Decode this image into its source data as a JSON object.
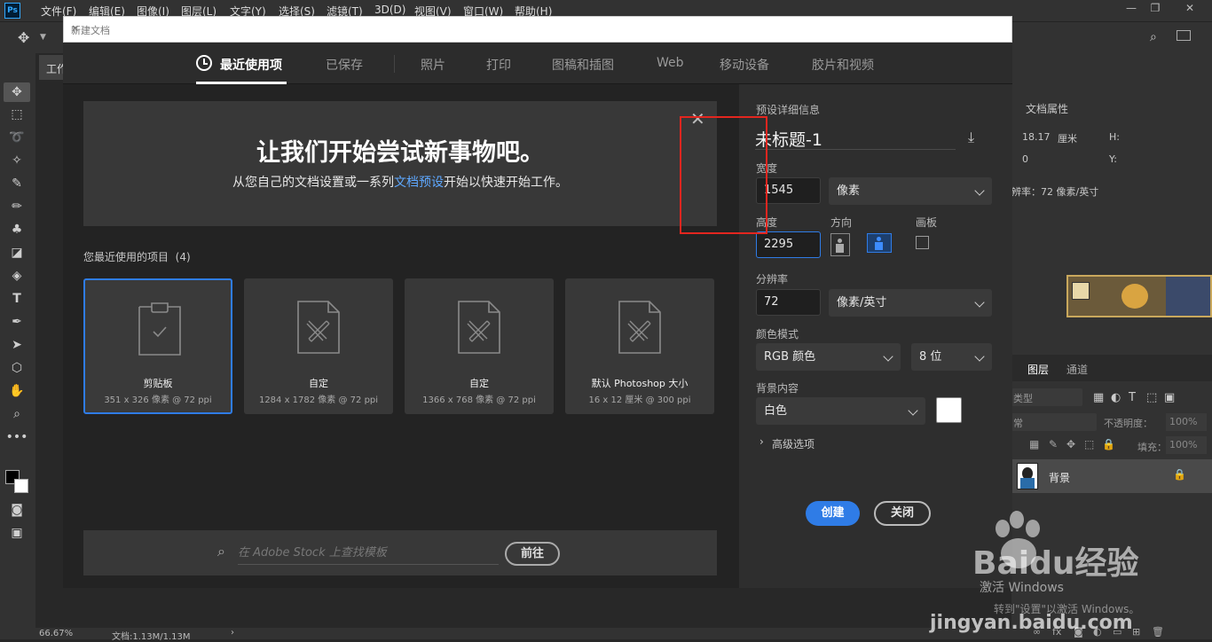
{
  "menubar": {
    "logo": "Ps",
    "items": [
      "文件(F)",
      "编辑(E)",
      "图像(I)",
      "图层(L)",
      "文字(Y)",
      "选择(S)",
      "滤镜(T)",
      "3D(D)",
      "视图(V)",
      "窗口(W)",
      "帮助(H)"
    ]
  },
  "workspace_tab": "工作",
  "dialog": {
    "title": "新建文档",
    "tabs": [
      "最近使用项",
      "已保存",
      "照片",
      "打印",
      "图稿和插图",
      "Web",
      "移动设备",
      "胶片和视频"
    ],
    "active_tab": 0,
    "welcome": {
      "title": "让我们开始尝试新事物吧。",
      "sub_before": "从您自己的文档设置或一系列",
      "sub_link": "文档预设",
      "sub_after": "开始以快速开始工作。"
    },
    "recent_label": "您最近使用的项目",
    "recent_count": "(4)",
    "recent": [
      {
        "name": "剪贴板",
        "detail": "351 x 326 像素 @ 72 ppi",
        "selected": true,
        "icon": "clipboard-icon"
      },
      {
        "name": "自定",
        "detail": "1284 x 1782 像素 @ 72 ppi",
        "selected": false,
        "icon": "document-ruler-icon"
      },
      {
        "name": "自定",
        "detail": "1366 x 768 像素 @ 72 ppi",
        "selected": false,
        "icon": "document-ruler-icon"
      },
      {
        "name": "默认 Photoshop 大小",
        "detail": "16 x 12 厘米 @ 300 ppi",
        "selected": false,
        "icon": "document-ruler-icon"
      }
    ],
    "stock": {
      "placeholder": "在 Adobe Stock 上查找模板",
      "button": "前往"
    },
    "details": {
      "header": "预设详细信息",
      "doc_name": "未标题-1",
      "width_label": "宽度",
      "width_value": "1545",
      "width_unit": "像素",
      "height_label": "高度",
      "height_value": "2295",
      "orientation_label": "方向",
      "artboard_label": "画板",
      "resolution_label": "分辨率",
      "resolution_value": "72",
      "resolution_unit": "像素/英寸",
      "color_mode_label": "颜色模式",
      "color_mode": "RGB 颜色",
      "bit_depth": "8 位",
      "background_label": "背景内容",
      "background": "白色",
      "advanced": "高级选项",
      "create": "创建",
      "close": "关闭"
    }
  },
  "rpanel": {
    "doc_props": "文档属性",
    "w_value": "18.17",
    "w_unit": "厘米",
    "h_label": "H:",
    "x_value": "0",
    "y_label": "Y:",
    "resolution": "辨率：72 像素/英寸",
    "layers_tab": "图层",
    "channels_tab": "通道",
    "kind_label": "类型",
    "blend_mode": "常",
    "opacity_label": "不透明度：",
    "opacity_value": "100%",
    "fill_label": "填充：",
    "fill_value": "100%",
    "layer_name": "背景"
  },
  "statusbar": {
    "zoom": "66.67%",
    "doc": "文档:1.13M/1.13M"
  },
  "watermark": {
    "brand": "Baidu经验",
    "url": "jingyan.baidu.com",
    "activate": "激活 Windows",
    "activate_sub": "转到\"设置\"以激活 Windows。"
  }
}
